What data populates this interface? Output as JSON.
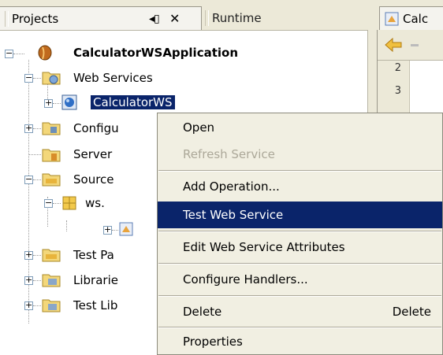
{
  "tabs": {
    "projects": "Projects",
    "runtime": "Runtime",
    "editor": "Calc"
  },
  "tab_controls": {
    "minimize": "◂▯",
    "close": "✕"
  },
  "editor": {
    "line_numbers": [
      "2",
      "3"
    ]
  },
  "tree": {
    "root": "CalculatorWSApplication",
    "web_services": "Web Services",
    "calculator_ws": "CalculatorWS",
    "configuration": "Configu",
    "server": "Server",
    "source": "Source",
    "package": "ws.",
    "test_packages": "Test Pa",
    "libraries": "Librarie",
    "test_libraries": "Test Lib"
  },
  "context_menu": {
    "items": [
      {
        "label": "Open",
        "enabled": true
      },
      {
        "label": "Refresh Service",
        "enabled": false
      },
      {
        "label": "Add Operation...",
        "enabled": true
      },
      {
        "label": "Test Web Service",
        "enabled": true,
        "highlighted": true
      },
      {
        "label": "Edit Web Service Attributes",
        "enabled": true
      },
      {
        "label": "Configure Handlers...",
        "enabled": true
      },
      {
        "label": "Delete",
        "enabled": true,
        "shortcut": "Delete"
      },
      {
        "label": "Properties",
        "enabled": true
      }
    ]
  },
  "colors": {
    "selection": "#0a246a",
    "menu_background": "#f1efe2",
    "chrome": "#ece9d8",
    "disabled_text": "#aca899"
  }
}
